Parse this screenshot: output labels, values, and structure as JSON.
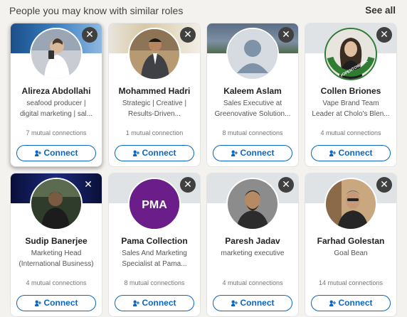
{
  "header": {
    "title": "People you may know with similar roles",
    "see_all": "See all"
  },
  "cards": [
    {
      "name": "Alireza Abdollahi",
      "headline": [
        "seafood producer |",
        "digital marketing | sal..."
      ],
      "mutual": "7 mutual connections",
      "connect": "Connect"
    },
    {
      "name": "Mohammed Hadri",
      "headline": [
        "Strategic | Creative |",
        "Results-Driven..."
      ],
      "mutual": "1 mutual connection",
      "connect": "Connect"
    },
    {
      "name": "Kaleem Aslam",
      "headline": [
        "Sales Executive at",
        "Greenovative Solution..."
      ],
      "mutual": "8 mutual connections",
      "connect": "Connect"
    },
    {
      "name": "Collen Briones",
      "headline": [
        "Vape Brand Team",
        "Leader at Cholo's Blen..."
      ],
      "mutual": "4 mutual connections",
      "connect": "Connect"
    },
    {
      "name": "Sudip Banerjee",
      "headline": [
        "Marketing Head",
        "(International Business)"
      ],
      "mutual": "4 mutual connections",
      "connect": "Connect"
    },
    {
      "name": "Pama Collection",
      "headline": [
        "Sales And Marketing",
        "Specialist at Pama..."
      ],
      "mutual": "8 mutual connections",
      "connect": "Connect",
      "logo_text": "PMA"
    },
    {
      "name": "Paresh Jadav",
      "headline": [
        "marketing executive"
      ],
      "mutual": "4 mutual connections",
      "connect": "Connect"
    },
    {
      "name": "Farhad Golestan",
      "headline": [
        "Goal Bean"
      ],
      "mutual": "14 mutual connections",
      "connect": "Connect"
    }
  ],
  "badge_text": "#OPENTOWORK",
  "colors": {
    "accent": "#0a66c2",
    "open_to_work": "#2e7d32",
    "pama_purple": "#6b1d8a"
  }
}
